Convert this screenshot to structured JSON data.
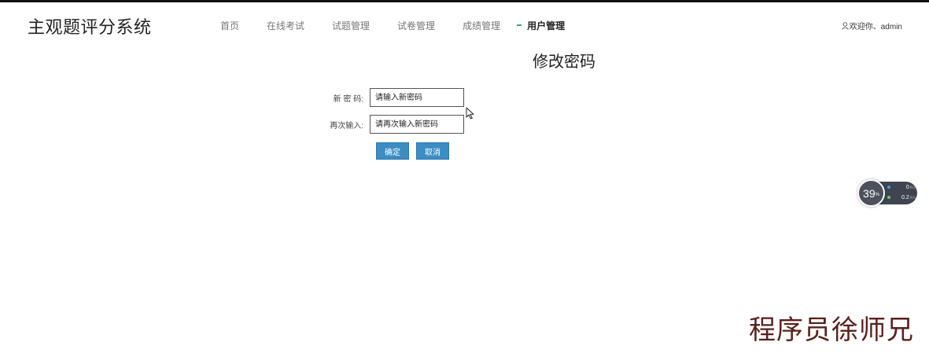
{
  "app": {
    "title": "主观题评分系统"
  },
  "nav": {
    "items": [
      {
        "label": "首页"
      },
      {
        "label": "在线考试"
      },
      {
        "label": "试题管理"
      },
      {
        "label": "试卷管理"
      },
      {
        "label": "成绩管理"
      },
      {
        "label": "用户管理"
      }
    ]
  },
  "user": {
    "greeting": "欢迎你、admin",
    "icon": "user-icon"
  },
  "page": {
    "title": "修改密码"
  },
  "form": {
    "new_password": {
      "label": "新 密 码:",
      "placeholder": "请输入新密码",
      "value": ""
    },
    "confirm_password": {
      "label": "再次输入:",
      "placeholder": "请再次输入新密码",
      "value": ""
    },
    "ok_label": "确定",
    "cancel_label": "取消"
  },
  "net_monitor": {
    "percent": "39",
    "percent_unit": "%",
    "upload": "0",
    "download": "0.2",
    "unit": "K/s",
    "up_color": "#3aa0e0",
    "down_color": "#5ccf5c"
  },
  "watermark": {
    "text": "程序员徐师兄"
  },
  "colors": {
    "accent": "#3c8dc4",
    "nav_active_marker": "#3aa87a",
    "watermark": "#5a1f1a"
  }
}
